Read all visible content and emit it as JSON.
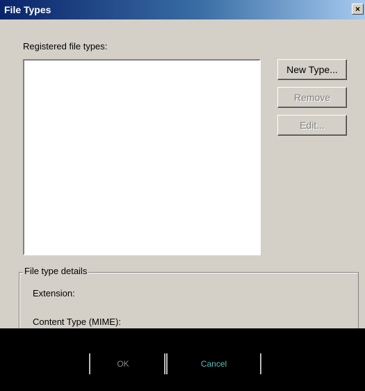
{
  "window": {
    "title": "File Types",
    "close_glyph": "×"
  },
  "list": {
    "label": "Registered file types:",
    "items": []
  },
  "buttons": {
    "new_type": "New Type...",
    "remove": "Remove",
    "edit": "Edit...",
    "ok": "OK",
    "cancel": "Cancel"
  },
  "details": {
    "legend": "File type details",
    "extension_label": "Extension:",
    "content_type_label": "Content Type (MIME):"
  },
  "colors": {
    "titlebar_start": "#0a246a",
    "titlebar_end": "#a6caf0",
    "face": "#d4d0c8"
  }
}
